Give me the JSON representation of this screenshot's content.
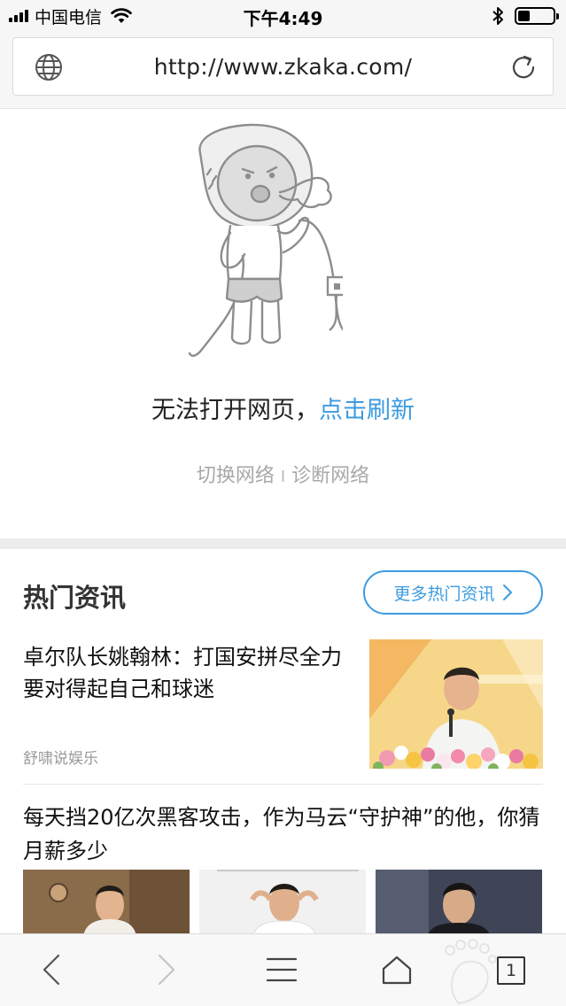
{
  "status_bar": {
    "carrier": "中国电信",
    "time": "下午4:49",
    "battery_level": 0.35
  },
  "address_bar": {
    "url": "http://www.zkaka.com/",
    "globe_icon": "globe-icon",
    "reload_icon": "reload-icon"
  },
  "error_page": {
    "message": "无法打开网页，",
    "refresh_link": "点击刷新",
    "switch_network": "切换网络",
    "separator": "I",
    "diagnose_network": "诊断网络"
  },
  "news": {
    "title": "热门资讯",
    "more_label": "更多热门资讯",
    "articles": [
      {
        "title": "卓尔队长姚翰林：打国安拼尽全力 要对得起自己和球迷",
        "source": "舒啸说娱乐"
      },
      {
        "title": "每天挡20亿次黑客攻击，作为马云“守护神”的他，你猜月薪多少",
        "source": ""
      }
    ]
  },
  "toolbar": {
    "tab_count": "1",
    "icons": [
      "back-icon",
      "forward-icon",
      "menu-icon",
      "home-icon",
      "tabs-icon"
    ]
  },
  "colors": {
    "accent": "#3d9be0",
    "muted_text": "#a8a8a8",
    "band": "#ececec"
  }
}
